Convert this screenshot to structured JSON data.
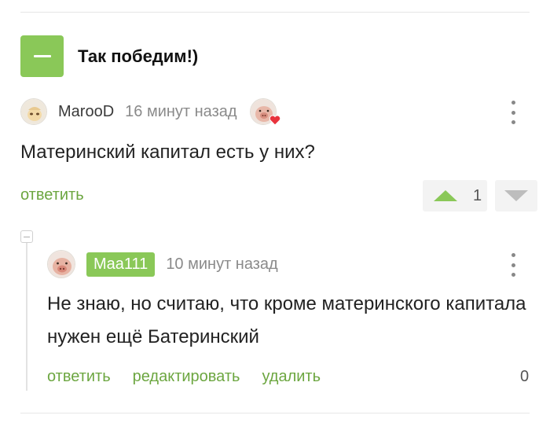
{
  "post": {
    "title": "Так победим!)"
  },
  "comment1": {
    "username": "MarooD",
    "time": "16 минут назад",
    "text": "Материнский капитал есть у них?",
    "reply_label": "ответить",
    "rating": "1"
  },
  "comment2": {
    "username": "Maa111",
    "time": "10 минут назад",
    "text": "Не знаю, но считаю, что кроме материнского капитала нужен ещё Батеринский",
    "actions": {
      "reply": "ответить",
      "edit": "редактировать",
      "delete": "удалить"
    },
    "rating": "0"
  },
  "colors": {
    "accent": "#8ac858",
    "link": "#6ca640",
    "muted": "#8a8a8a"
  }
}
